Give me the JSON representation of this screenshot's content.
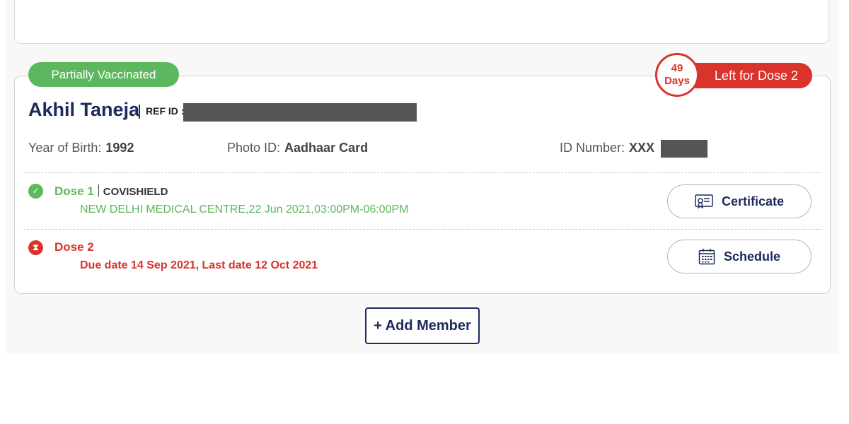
{
  "member": {
    "status": "Partially Vaccinated",
    "days_count": "49",
    "days_unit": "Days",
    "days_left_label": "Left for Dose 2",
    "name": "Akhil Taneja",
    "ref_label": "REF ID :",
    "year_of_birth_label": "Year of Birth:",
    "year_of_birth_value": "1992",
    "photo_id_label": "Photo ID:",
    "photo_id_value": "Aadhaar Card",
    "id_number_label": "ID Number:",
    "id_number_value": "XXX"
  },
  "dose1": {
    "title": "Dose 1",
    "vaccine": "COVISHIELD",
    "details": "NEW DELHI MEDICAL CENTRE,22 Jun 2021,03:00PM-06:00PM",
    "button_label": "Certificate",
    "button_icon": "certificate-icon",
    "status_icon": "check-circle-icon"
  },
  "dose2": {
    "title": "Dose 2",
    "details": "Due date 14 Sep 2021, Last date  12 Oct 2021",
    "button_label": "Schedule",
    "button_icon": "calendar-icon",
    "status_icon": "hourglass-icon"
  },
  "add_member_label": "+ Add Member",
  "colors": {
    "green": "#5cb85c",
    "red": "#d9332b",
    "navy": "#1c2a5c"
  }
}
